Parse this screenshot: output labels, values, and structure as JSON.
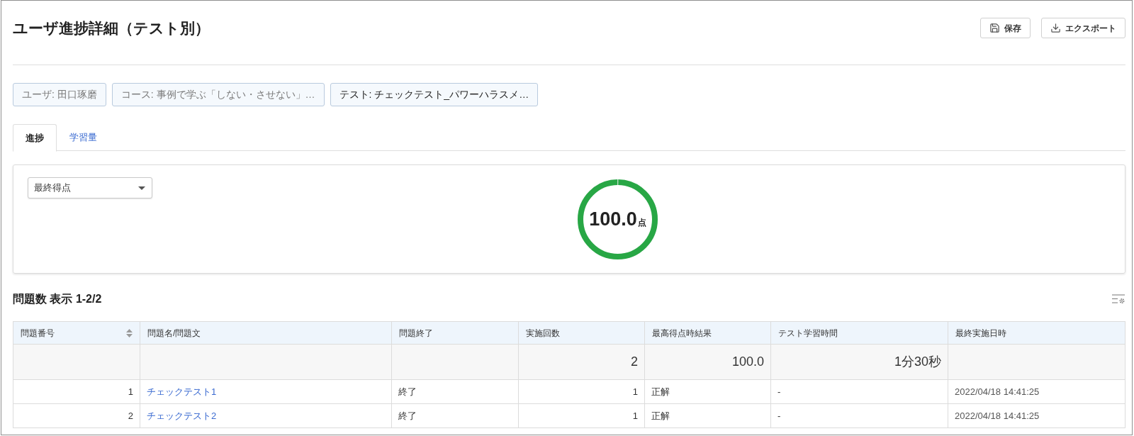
{
  "page": {
    "title": "ユーザ進捗詳細（テスト別）",
    "actions": [
      {
        "label": "保存",
        "kind": "save"
      },
      {
        "label": "エクスポート",
        "kind": "export"
      }
    ]
  },
  "filters": [
    {
      "label": "ユーザ: 田口琢磨",
      "selected": false
    },
    {
      "label": "コース: 事例で学ぶ「しない・させない」…",
      "selected": false
    },
    {
      "label": "テスト: チェックテスト_パワーハラスメ…",
      "selected": true
    }
  ],
  "tabs": [
    {
      "label": "進捗",
      "selected": true
    },
    {
      "label": "学習量",
      "selected": false
    }
  ],
  "progress_panel": {
    "metric_select": {
      "value": "最終得点"
    },
    "score": {
      "value": "100.0",
      "unit": "点",
      "level": 1
    }
  },
  "questions": {
    "heading": "問題数 表示 1-2/2",
    "columns": [
      {
        "label": "問題番号",
        "sortable": true
      },
      {
        "label": "問題名/問題文",
        "sortable": false
      },
      {
        "label": "問題終了",
        "sortable": false
      },
      {
        "label": "実施回数",
        "sortable": false
      },
      {
        "label": "最高得点時結果",
        "sortable": false
      },
      {
        "label": "テスト学習時間",
        "sortable": false
      },
      {
        "label": "最終実施日時",
        "sortable": false
      }
    ],
    "summary": {
      "attempts": "2",
      "result": "100.0",
      "study_time": "1分30秒"
    },
    "rows": [
      {
        "no": "1",
        "name": "チェックテスト1",
        "status": "終了",
        "attempts": "1",
        "result": "正解",
        "study_time": "-",
        "last_run": "2022/04/18 14:41:25"
      },
      {
        "no": "2",
        "name": "チェックテスト2",
        "status": "終了",
        "attempts": "1",
        "result": "正解",
        "study_time": "-",
        "last_run": "2022/04/18 14:41:25"
      }
    ]
  }
}
